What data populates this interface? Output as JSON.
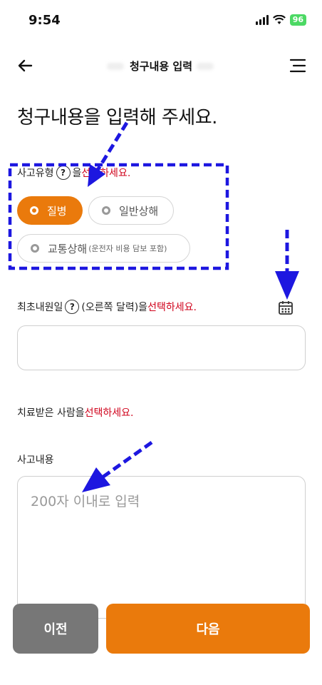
{
  "status_bar": {
    "time": "9:54",
    "battery": "96"
  },
  "header": {
    "title": "청구내용 입력"
  },
  "heading": "청구내용을 입력해 주세요.",
  "accident_type": {
    "label_prefix": "사고유형",
    "help": "?",
    "label_middle": "을 ",
    "label_action": "선택하세요.",
    "options": [
      {
        "label": "질병",
        "sub": "",
        "selected": true
      },
      {
        "label": "일반상해",
        "sub": "",
        "selected": false
      },
      {
        "label": "교통상해",
        "sub": "(운전자 비용 담보 포함)",
        "selected": false
      }
    ]
  },
  "first_visit": {
    "label_prefix": "최초내원일",
    "help": "?",
    "label_middle": "(오른쪽 달력)을 ",
    "label_action": "선택하세요.",
    "value": ""
  },
  "patient": {
    "label_prefix": "치료받은 사람을 ",
    "label_action": "선택하세요."
  },
  "details": {
    "label": "사고내용",
    "placeholder": "200자 이내로 입력"
  },
  "buttons": {
    "prev": "이전",
    "next": "다음"
  },
  "colors": {
    "accent": "#ea7a0c",
    "required": "#d0021b",
    "annotation": "#1d17e0"
  }
}
